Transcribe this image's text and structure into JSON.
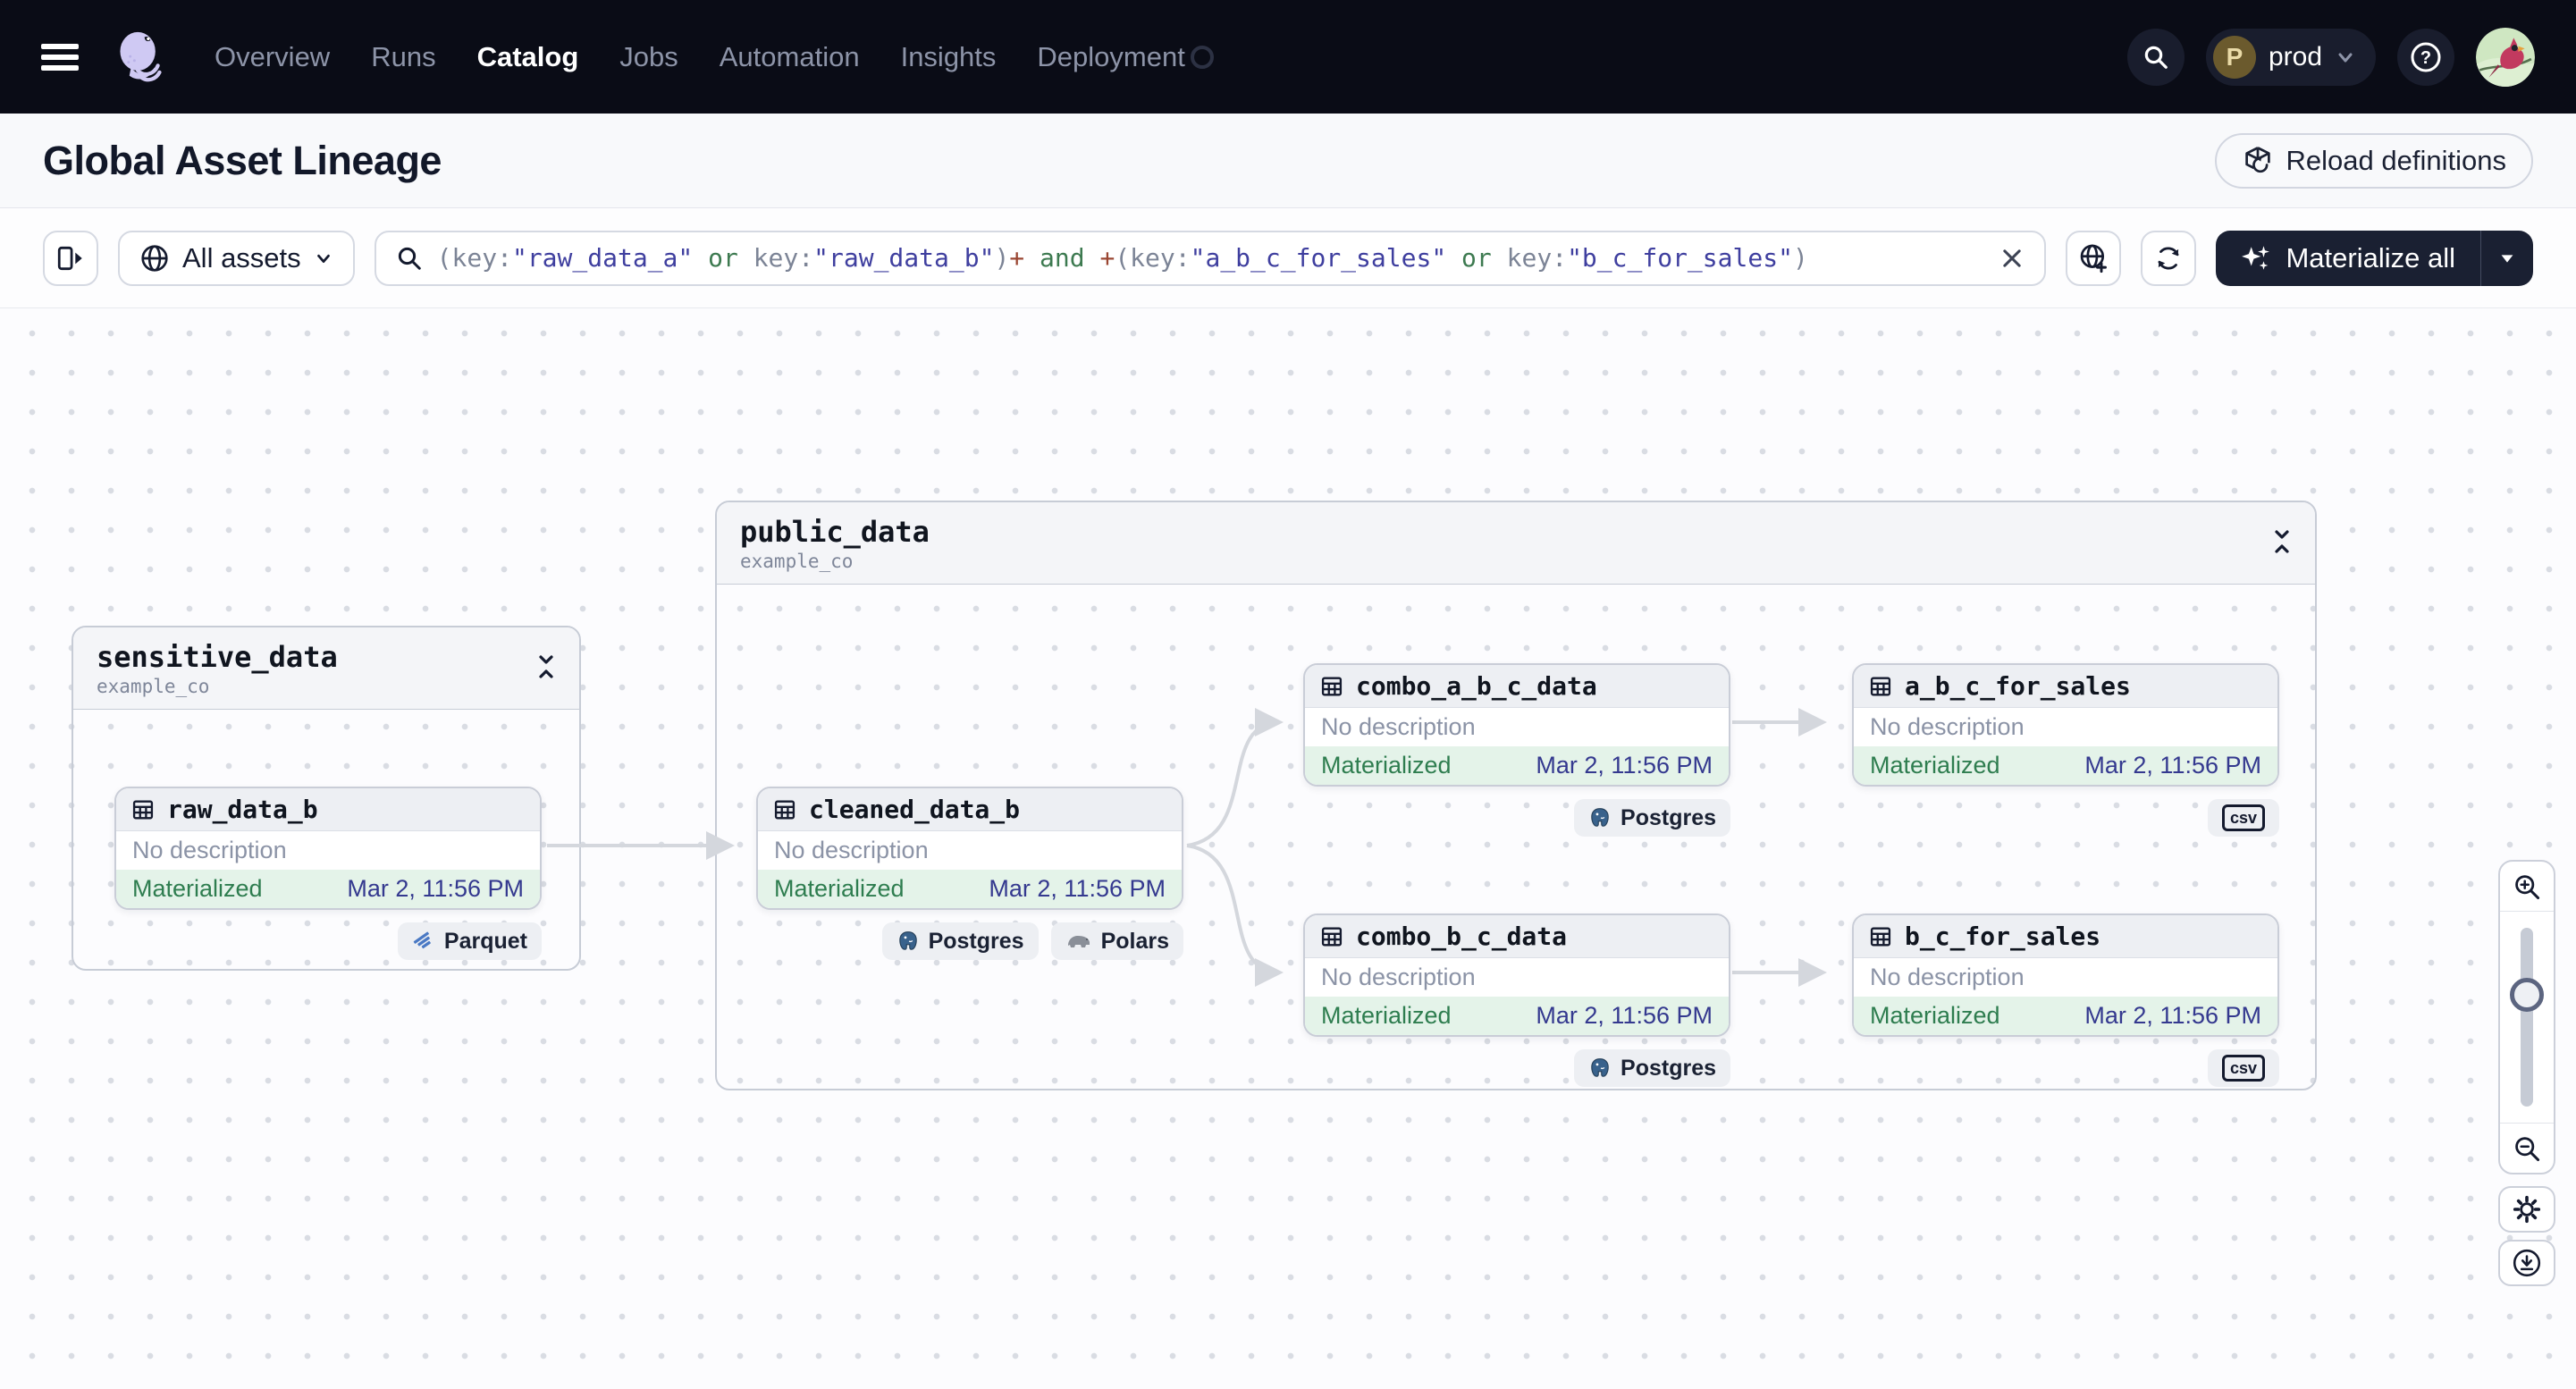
{
  "nav": {
    "items": [
      "Overview",
      "Runs",
      "Catalog",
      "Jobs",
      "Automation",
      "Insights",
      "Deployment"
    ],
    "active_item": "Catalog",
    "deployment_label": "prod",
    "deployment_initial": "P"
  },
  "page": {
    "title": "Global Asset Lineage",
    "reload_definitions_label": "Reload definitions"
  },
  "toolbar": {
    "scope_label": "All assets",
    "materialize_label": "Materialize all",
    "query_segments": [
      {
        "text": "(key:",
        "style": "punct"
      },
      {
        "text": "\"raw_data_a\"",
        "style": "str"
      },
      {
        "text": " or ",
        "style": "kw"
      },
      {
        "text": "key:",
        "style": "punct"
      },
      {
        "text": "\"raw_data_b\"",
        "style": "str"
      },
      {
        "text": ")",
        "style": "punct"
      },
      {
        "text": "+",
        "style": "op"
      },
      {
        "text": " and ",
        "style": "kw"
      },
      {
        "text": "+",
        "style": "op"
      },
      {
        "text": "(key:",
        "style": "punct"
      },
      {
        "text": "\"a_b_c_for_sales\"",
        "style": "str"
      },
      {
        "text": " or ",
        "style": "kw"
      },
      {
        "text": "key:",
        "style": "punct"
      },
      {
        "text": "\"b_c_for_sales\"",
        "style": "str"
      },
      {
        "text": ")",
        "style": "punct"
      }
    ]
  },
  "graph": {
    "groups": [
      {
        "name": "sensitive_data",
        "location": "example_co"
      },
      {
        "name": "public_data",
        "location": "example_co"
      }
    ],
    "nodes": [
      {
        "name": "raw_data_b",
        "description": "No description",
        "status": "Materialized",
        "timestamp": "Mar 2, 11:56 PM",
        "badges": [
          {
            "icon": "parquet",
            "label": "Parquet"
          }
        ]
      },
      {
        "name": "cleaned_data_b",
        "description": "No description",
        "status": "Materialized",
        "timestamp": "Mar 2, 11:56 PM",
        "badges": [
          {
            "icon": "postgres",
            "label": "Postgres"
          },
          {
            "icon": "polars",
            "label": "Polars"
          }
        ]
      },
      {
        "name": "combo_a_b_c_data",
        "description": "No description",
        "status": "Materialized",
        "timestamp": "Mar 2, 11:56 PM",
        "badges": [
          {
            "icon": "postgres",
            "label": "Postgres"
          }
        ]
      },
      {
        "name": "a_b_c_for_sales",
        "description": "No description",
        "status": "Materialized",
        "timestamp": "Mar 2, 11:56 PM",
        "badges": [
          {
            "icon": "csv",
            "label": "csv"
          }
        ]
      },
      {
        "name": "combo_b_c_data",
        "description": "No description",
        "status": "Materialized",
        "timestamp": "Mar 2, 11:56 PM",
        "badges": [
          {
            "icon": "postgres",
            "label": "Postgres"
          }
        ]
      },
      {
        "name": "b_c_for_sales",
        "description": "No description",
        "status": "Materialized",
        "timestamp": "Mar 2, 11:56 PM",
        "badges": [
          {
            "icon": "csv",
            "label": "csv"
          }
        ]
      }
    ]
  },
  "colors": {
    "nav_bg": "#0a0c16",
    "status_green": "#2e7d4f",
    "timestamp_indigo": "#34398f",
    "query_string": "#3f3f9f",
    "query_keyword": "#3d7a50",
    "query_operator": "#9a4632",
    "edge_gray": "#d4d7dd"
  }
}
